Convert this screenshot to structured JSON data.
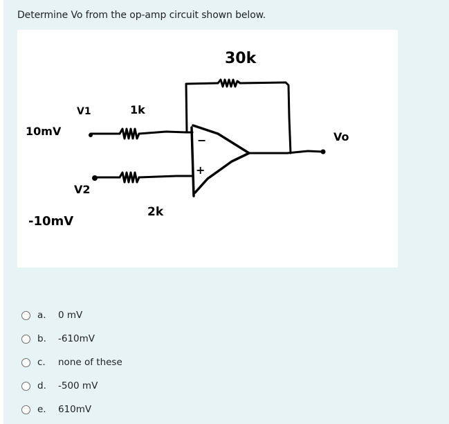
{
  "question": {
    "text": "Determine Vo from the op-amp circuit shown below."
  },
  "figure": {
    "labels": {
      "feedback_resistor": "30k",
      "r1": "1k",
      "r2": "2k",
      "v1_name": "V1",
      "v1_value": "10mV",
      "v2_name": "V2",
      "v2_value": "-10mV",
      "inverting_sign": "−",
      "noninverting_sign": "+",
      "output": "Vo"
    }
  },
  "options": [
    {
      "letter": "a.",
      "text": "0 mV",
      "selected": false
    },
    {
      "letter": "b.",
      "text": "-610mV",
      "selected": false
    },
    {
      "letter": "c.",
      "text": "none of these",
      "selected": false
    },
    {
      "letter": "d.",
      "text": "-500 mV",
      "selected": false
    },
    {
      "letter": "e.",
      "text": "610mV",
      "selected": false
    }
  ]
}
